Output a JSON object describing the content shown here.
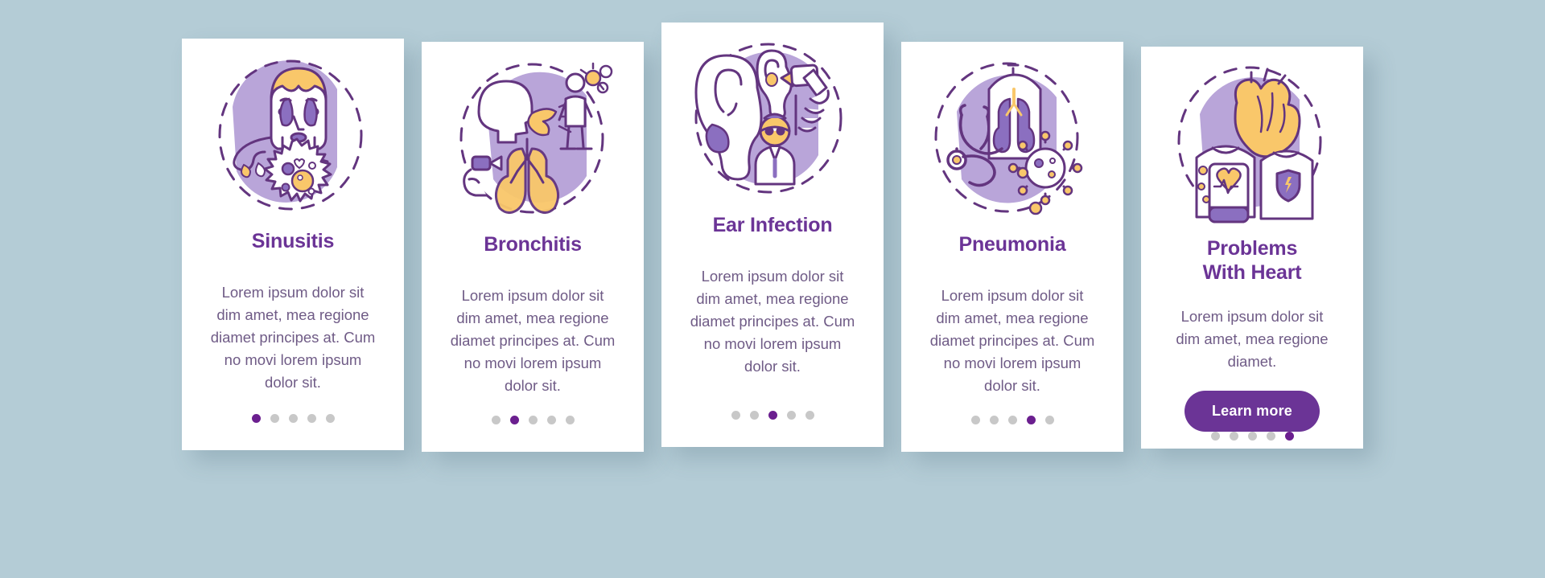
{
  "page": {
    "background_color": "#b4ccd6",
    "card_background": "#ffffff",
    "title_color": "#6b3496",
    "body_color": "#6f5b86",
    "accent_color": "#6b1f8f",
    "dot_inactive_color": "#c8c8c8",
    "blob_color": "#b9a5d9",
    "line_color": "#63357f",
    "highlight_color": "#f9c76a"
  },
  "cards": [
    {
      "id": "sinusitis",
      "illustration_name": "sinusitis-illustration",
      "title": "Sinusitis",
      "body": "Lorem ipsum dolor sit dim amet, mea regione diamet principes at. Cum no movi lorem ipsum dolor sit.",
      "dots_total": 5,
      "dots_active_index": 0,
      "has_button": false,
      "button_label": ""
    },
    {
      "id": "bronchitis",
      "illustration_name": "bronchitis-illustration",
      "title": "Bronchitis",
      "body": "Lorem ipsum dolor sit dim amet, mea regione diamet principes at. Cum no movi lorem ipsum dolor sit.",
      "dots_total": 5,
      "dots_active_index": 1,
      "has_button": false,
      "button_label": ""
    },
    {
      "id": "ear-infection",
      "illustration_name": "ear-infection-illustration",
      "title": "Ear Infection",
      "body": "Lorem ipsum dolor sit dim amet, mea regione diamet principes at. Cum no movi lorem ipsum dolor sit.",
      "dots_total": 5,
      "dots_active_index": 2,
      "has_button": false,
      "button_label": ""
    },
    {
      "id": "pneumonia",
      "illustration_name": "pneumonia-illustration",
      "title": "Pneumonia",
      "body": "Lorem ipsum dolor sit dim amet, mea regione diamet principes at. Cum no movi lorem ipsum dolor sit.",
      "dots_total": 5,
      "dots_active_index": 3,
      "has_button": false,
      "button_label": ""
    },
    {
      "id": "problems-with-heart",
      "illustration_name": "heart-problems-illustration",
      "title": "Problems\nWith Heart",
      "body": "Lorem ipsum dolor sit dim amet, mea regione diamet.",
      "dots_total": 5,
      "dots_active_index": 4,
      "has_button": true,
      "button_label": "Learn more"
    }
  ]
}
